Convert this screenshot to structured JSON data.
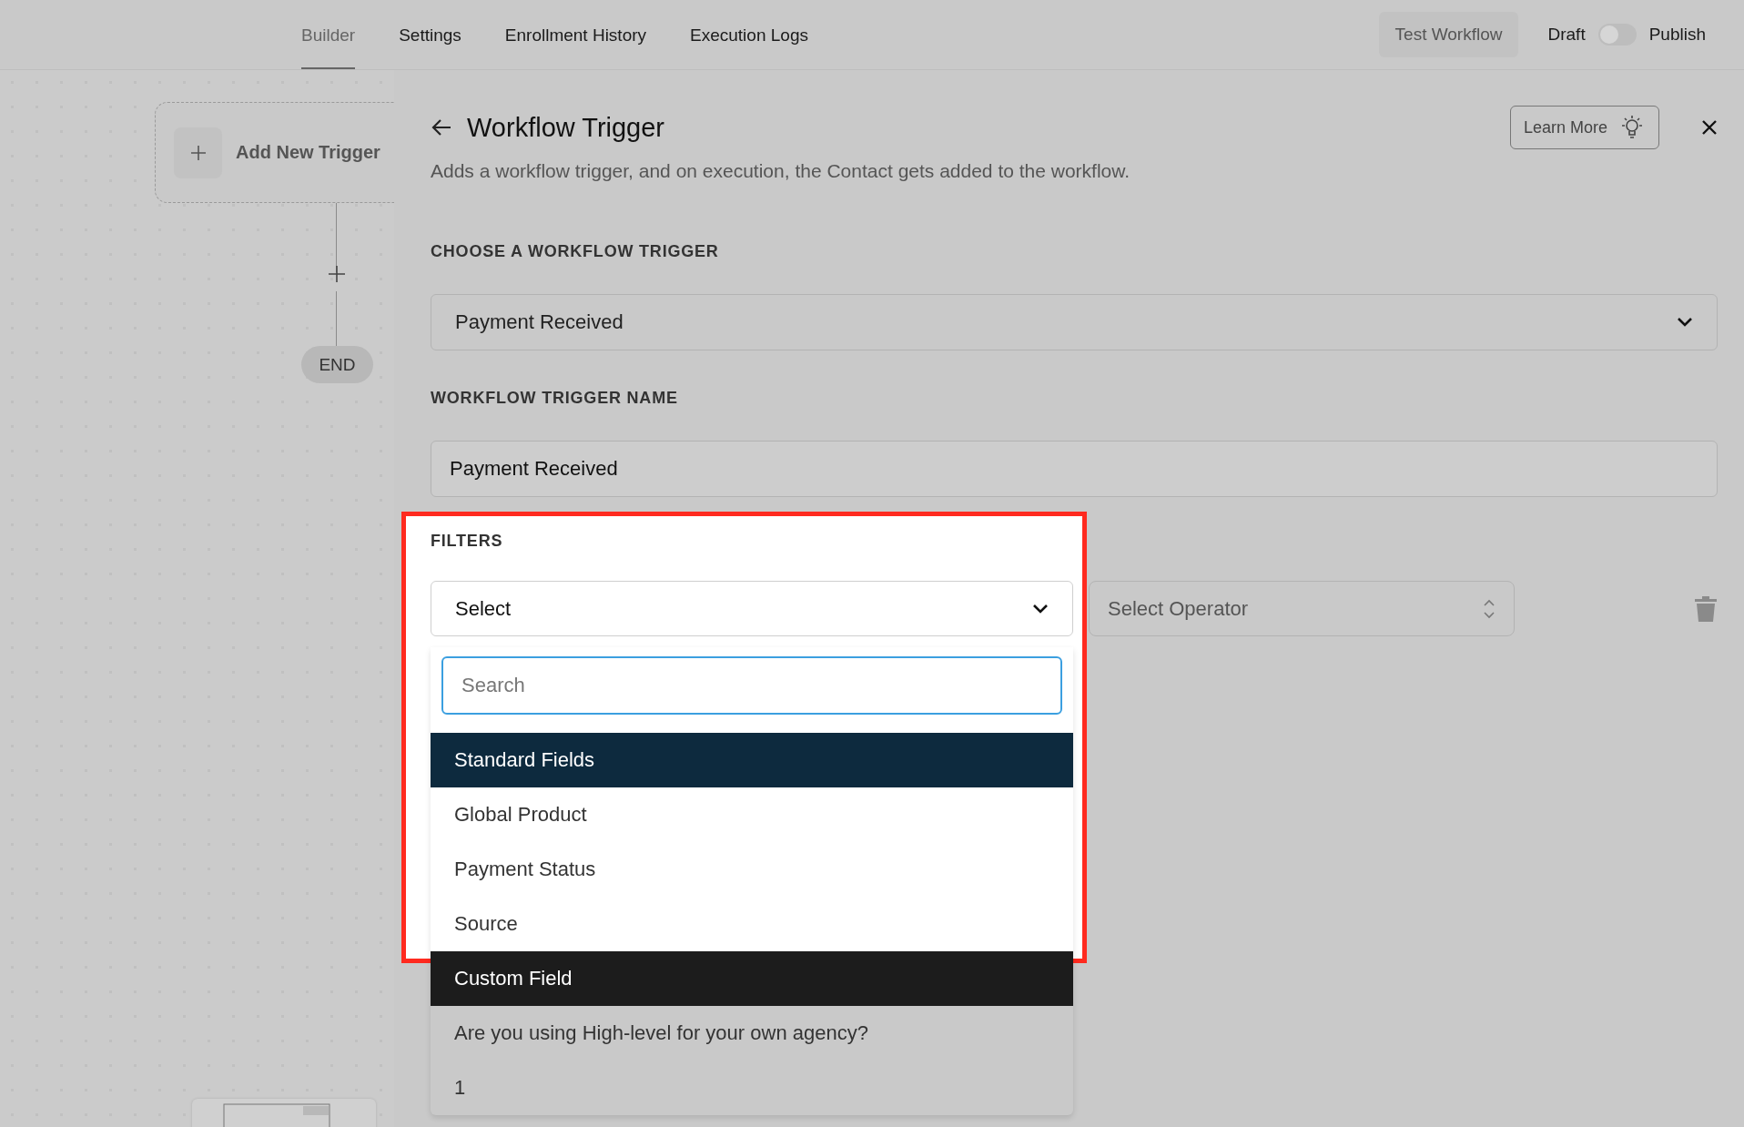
{
  "tabs": [
    {
      "label": "Builder",
      "selected": true
    },
    {
      "label": "Settings",
      "selected": false
    },
    {
      "label": "Enrollment History",
      "selected": false
    },
    {
      "label": "Execution Logs",
      "selected": false
    }
  ],
  "header_actions": {
    "test_button": "Test Workflow",
    "draft_label": "Draft",
    "toggle": {
      "on": false
    },
    "publish_label": "Publish"
  },
  "canvas": {
    "trigger_node": {
      "label": "Add New Trigger"
    },
    "end_node": {
      "label": "END"
    }
  },
  "panel": {
    "title": "Workflow Trigger",
    "subtitle": "Adds a workflow trigger, and on execution, the Contact gets added to the workflow.",
    "learn_more": "Learn More",
    "trigger_select": {
      "label": "CHOOSE A WORKFLOW TRIGGER",
      "value": "Payment Received"
    },
    "trigger_name": {
      "label": "WORKFLOW TRIGGER NAME",
      "value": "Payment Received"
    },
    "filters": {
      "label": "FILTERS",
      "field_select": {
        "value": "Select",
        "expanded": true
      },
      "operator_select": {
        "placeholder": "Select Operator"
      },
      "search": {
        "placeholder": "Search"
      },
      "groups": [
        {
          "title": "Standard Fields",
          "color": "#0d2a3e",
          "options": [
            "Global Product",
            "Payment Status",
            "Source"
          ]
        },
        {
          "title": "Custom Field",
          "color": "#1c1c1c",
          "options": [
            "Are you using High-level for your own agency?",
            "1"
          ]
        }
      ]
    }
  }
}
